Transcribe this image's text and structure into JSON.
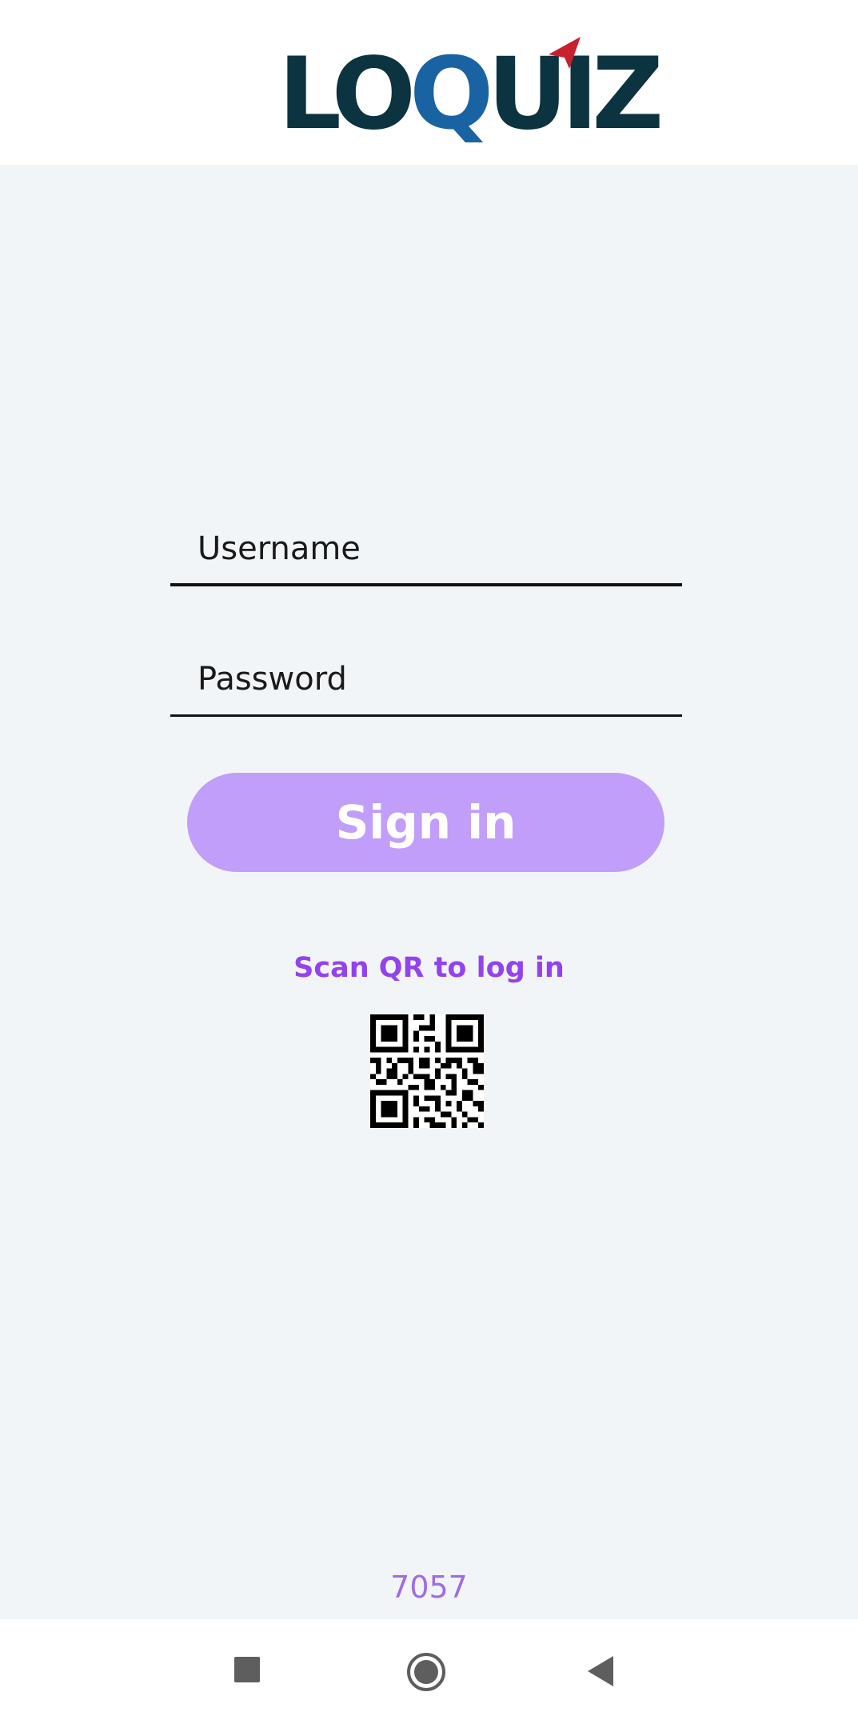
{
  "app": {
    "logo_text": "LOQUIZ",
    "colors": {
      "logo_dark": "#0c3340",
      "logo_q": "#1a63a3",
      "logo_arrow": "#c8202e",
      "accent": "#9442ef",
      "button": "#c19efa",
      "background": "#f2f5f8"
    }
  },
  "form": {
    "username_placeholder": "Username",
    "password_placeholder": "Password",
    "signin_label": "Sign in",
    "qr_link_label": "Scan QR to log in"
  },
  "footer": {
    "version": "7057"
  },
  "navbar": {
    "recents_icon": "recents-square-icon",
    "home_icon": "home-circle-icon",
    "back_icon": "back-triangle-icon"
  }
}
